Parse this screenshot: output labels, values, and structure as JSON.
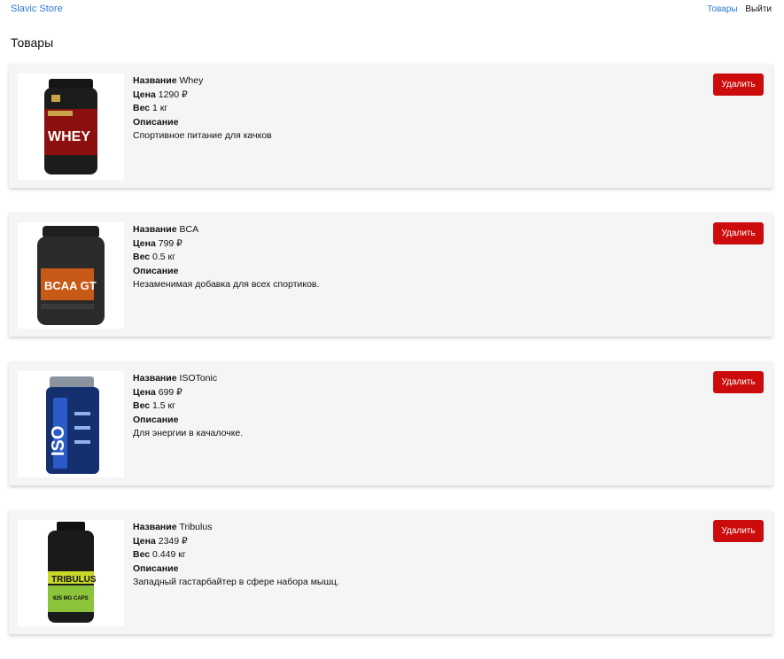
{
  "app": {
    "brand": "Slavic Store"
  },
  "nav": {
    "products": "Товары",
    "logout": "Выйти"
  },
  "page": {
    "title": "Товары"
  },
  "labels": {
    "name": "Название",
    "price": "Цена",
    "weight": "Вес",
    "description": "Описание",
    "delete": "Удалить"
  },
  "products": [
    {
      "name": "Whey",
      "price": "1290 ₽",
      "weight": "1 кг",
      "description": "Спортивное питание для качков",
      "image_icon": "whey-tub-image"
    },
    {
      "name": "BCA",
      "price": "799 ₽",
      "weight": "0.5 кг",
      "description": "Незаменимая добавка для всех спортиков.",
      "image_icon": "bcaa-tub-image"
    },
    {
      "name": "ISOTonic",
      "price": "699 ₽",
      "weight": "1.5 кг",
      "description": "Для энергии в качалочке.",
      "image_icon": "isotonic-jar-image"
    },
    {
      "name": "Tribulus",
      "price": "2349 ₽",
      "weight": "0.449 кг",
      "description": "Западный гастарбайтер в сфере набора мышц.",
      "image_icon": "tribulus-bottle-image"
    }
  ],
  "colors": {
    "link": "#2a7ad4",
    "delete_button": "#cc0c0c",
    "card_bg": "#f5f5f5"
  }
}
